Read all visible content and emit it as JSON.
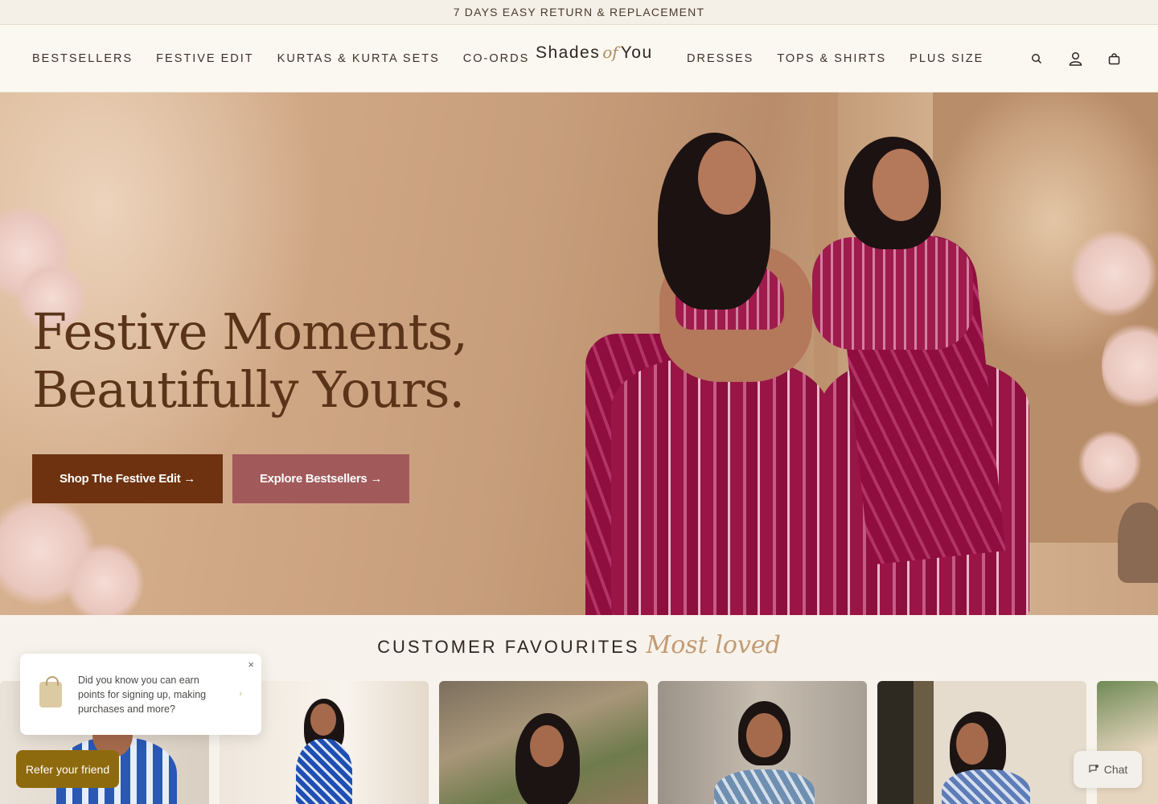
{
  "announcement": "7 DAYS EASY RETURN & REPLACEMENT",
  "logo": {
    "part1": "Shades",
    "part2": "of",
    "part3": "You"
  },
  "nav_left": [
    "BESTSELLERS",
    "FESTIVE EDIT",
    "KURTAS & KURTA SETS",
    "CO-ORDS"
  ],
  "nav_right": [
    "DRESSES",
    "TOPS & SHIRTS",
    "PLUS SIZE"
  ],
  "header_icons": [
    "search-icon",
    "account-icon",
    "cart-icon"
  ],
  "hero": {
    "line1": "Festive Moments,",
    "line2": "Beautifully Yours.",
    "btn_primary": "Shop The Festive Edit →",
    "btn_secondary": "Explore Bestsellers →"
  },
  "section": {
    "title": "CUSTOMER FAVOURITES",
    "script": "Most loved"
  },
  "popup": {
    "message": "Did you know you can earn points for signing up, making purchases and more?",
    "close": "×",
    "chevron": "›"
  },
  "refer": "Refer your friend",
  "chat": "Chat",
  "colors": {
    "primary_button": "#6e3210",
    "secondary_button": "#a2595a",
    "refer_button": "#8e6a0e",
    "headline": "#5a3418"
  }
}
